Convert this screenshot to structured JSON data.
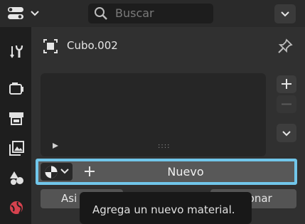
{
  "header": {
    "editor_type_icon": "properties-editor-icon",
    "search": {
      "placeholder": "Buscar"
    },
    "menu_icon": "chevron-down-icon"
  },
  "sidebar": {
    "tabs": [
      {
        "name": "tool",
        "icon": "wrench-screwdriver-icon"
      },
      {
        "name": "render",
        "icon": "camera-back-icon"
      },
      {
        "name": "output",
        "icon": "printer-icon"
      },
      {
        "name": "view-layer",
        "icon": "image-stack-icon"
      },
      {
        "name": "scene",
        "icon": "scene-shapes-icon"
      },
      {
        "name": "world",
        "icon": "globe-icon"
      }
    ]
  },
  "object": {
    "name": "Cubo.002",
    "icon": "cube-icon",
    "pin_icon": "pin-icon"
  },
  "slots": {
    "grip": "::::"
  },
  "new_button": {
    "label": "Nuevo",
    "browse_icon": "material-sphere-icon"
  },
  "mode_buttons": {
    "assign": "Asi",
    "select": "ccionar"
  },
  "tooltip": {
    "text": "Agrega un nuevo material."
  },
  "colors": {
    "highlight": "#71c6ea",
    "world_icon": "#d6424e"
  }
}
